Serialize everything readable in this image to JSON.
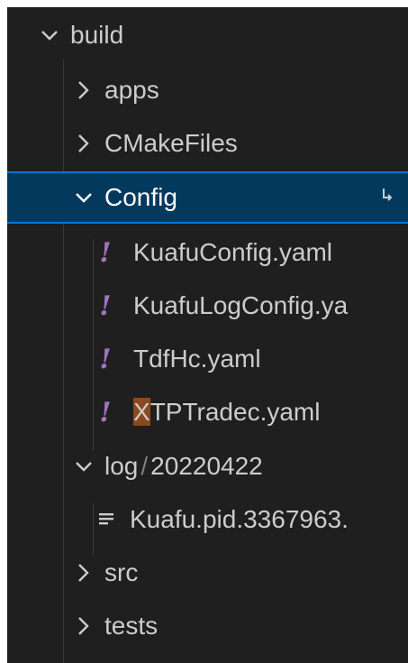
{
  "explorer": {
    "build": {
      "label": "build",
      "expanded": true
    },
    "apps": {
      "label": "apps",
      "expanded": false
    },
    "cmakefiles": {
      "label": "CMakeFiles",
      "expanded": false
    },
    "config": {
      "label": "Config",
      "expanded": true,
      "selected": true,
      "files": [
        "KuafuConfig.yaml",
        "KuafuLogConfig.ya",
        "TdfHc.yaml",
        "TPTradec.yaml"
      ],
      "highlight_prefix": "X"
    },
    "log": {
      "label_part1": "log",
      "separator": "/",
      "label_part2": "20220422",
      "expanded": true,
      "files": [
        "Kuafu.pid.3367963."
      ]
    },
    "src": {
      "label": "src",
      "expanded": false
    },
    "tests": {
      "label": "tests",
      "expanded": false
    }
  },
  "colors": {
    "background": "#1f1f1f",
    "selection": "#04395e",
    "selection_border": "#0078d4",
    "yaml_icon": "#a074c4",
    "text": "#cccccc"
  },
  "icons": {
    "expanded": "chevron-down-icon",
    "collapsed": "chevron-right-icon",
    "yaml": "yaml-file-icon",
    "text": "text-file-icon",
    "corner": "corner-arrow-icon"
  }
}
